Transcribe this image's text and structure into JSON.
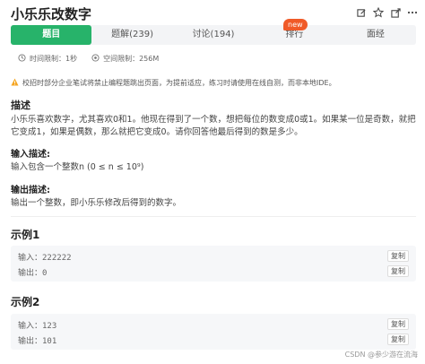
{
  "header": {
    "title": "小乐乐改数字",
    "icons": [
      "edit-icon",
      "star-icon",
      "share-icon",
      "more-icon"
    ]
  },
  "tabs": [
    {
      "label": "题目"
    },
    {
      "label": "题解(239)"
    },
    {
      "label": "讨论(194)"
    },
    {
      "label": "排行"
    },
    {
      "label": "面经"
    }
  ],
  "badge": {
    "label": "new"
  },
  "limits": {
    "time": "时间限制：1秒",
    "space": "空间限制：256M"
  },
  "notice": {
    "text": "校招时部分企业笔试将禁止编程题跳出页面，为提前适应，练习时请使用在线自测，而非本地IDE。"
  },
  "description": {
    "title": "描述",
    "text": "小乐乐喜欢数字，尤其喜欢0和1。他现在得到了一个数，想把每位的数变成0或1。如果某一位是奇数，就把它变成1，如果是偶数，那么就把它变成0。请你回答他最后得到的数是多少。"
  },
  "input_desc": {
    "title": "输入描述:",
    "text": "输入包含一个整数n (0 ≤ n ≤ 10⁹)"
  },
  "output_desc": {
    "title": "输出描述:",
    "text": "输出一个整数，即小乐乐修改后得到的数字。"
  },
  "examples": [
    {
      "title": "示例1",
      "input_label": "输入：",
      "input_value": "222222",
      "output_label": "输出：",
      "output_value": "0",
      "copy_label": "复制"
    },
    {
      "title": "示例2",
      "input_label": "输入：",
      "input_value": "123",
      "output_label": "输出：",
      "output_value": "101",
      "copy_label": "复制"
    }
  ],
  "watermark": "CSDN @参少游在流海",
  "colors": {
    "accent": "#27b36a",
    "badge": "#f05a28"
  }
}
